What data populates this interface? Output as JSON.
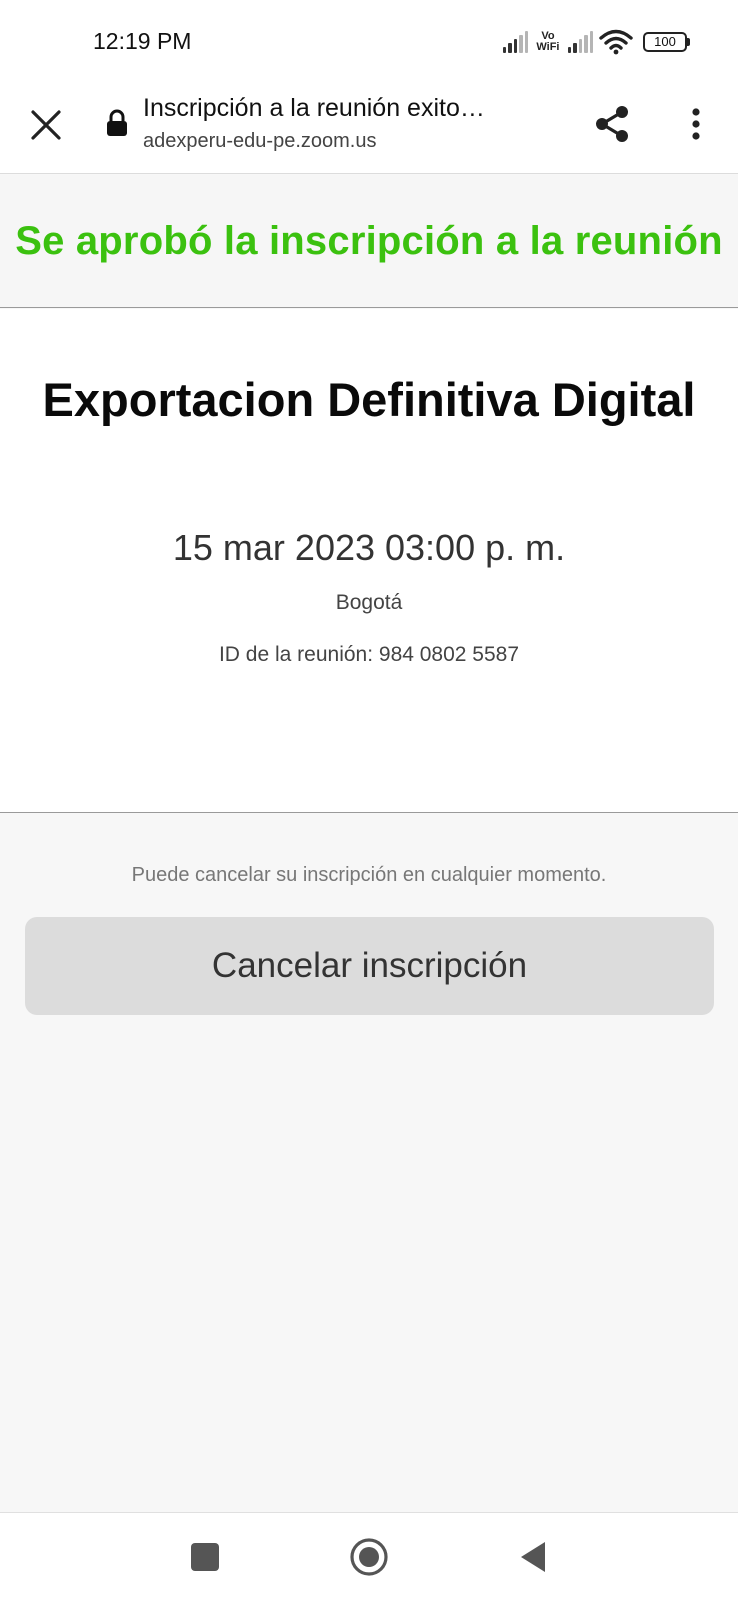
{
  "status_bar": {
    "time": "12:19 PM",
    "vowifi_top": "Vo",
    "vowifi_bottom": "WiFi",
    "battery": "100"
  },
  "browser": {
    "page_title": "Inscripción a la reunión exito…",
    "host": "adexperu-edu-pe.zoom.us"
  },
  "banner": {
    "text": "Se aprobó la inscripción a la reunión",
    "color": "#3bc10f"
  },
  "meeting": {
    "title": "Exportacion Definitiva Digital",
    "datetime": "15 mar 2023 03:00 p. m.",
    "timezone": "Bogotá",
    "meeting_id": "ID de la reunión: 984 0802 5587"
  },
  "cancel": {
    "note": "Puede cancelar su inscripción en cualquier momento.",
    "button_label": "Cancelar inscripción"
  },
  "icons": {
    "close": "close-icon",
    "lock": "lock-icon",
    "share": "share-icon",
    "more": "more-vert-icon",
    "recent": "recent-apps-icon",
    "home": "home-icon",
    "back": "back-icon"
  }
}
